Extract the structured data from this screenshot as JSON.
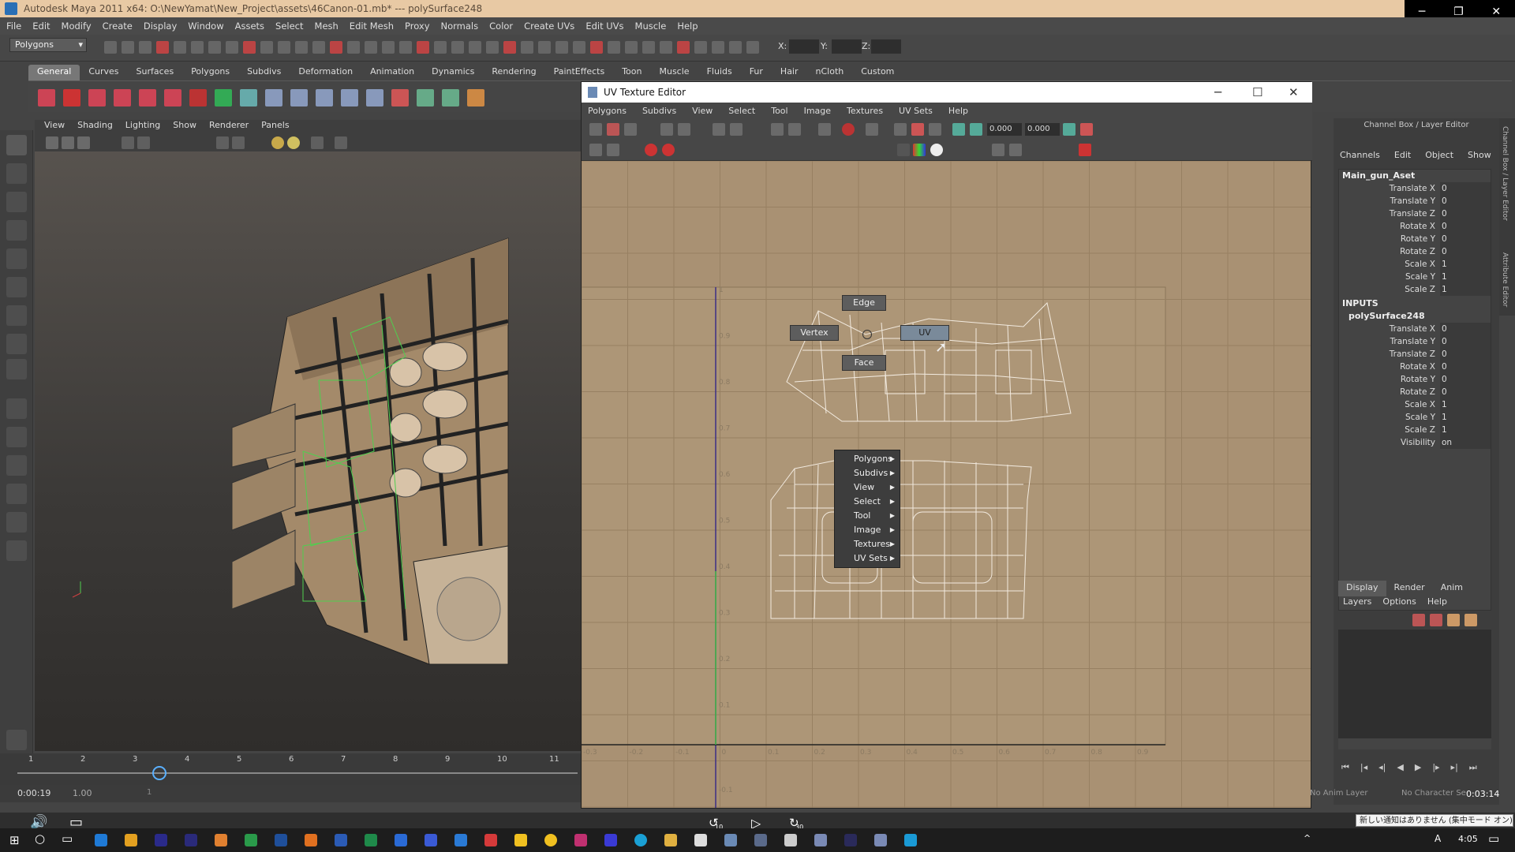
{
  "window": {
    "title": "Autodesk Maya 2011 x64: O:\\NewYamat\\New_Project\\assets\\46Canon-01.mb*   ---   polySurface248",
    "controls": {
      "minimize": "─",
      "restore": "❐",
      "close": "✕"
    }
  },
  "main_menu": [
    "File",
    "Edit",
    "Modify",
    "Create",
    "Display",
    "Window",
    "Assets",
    "Select",
    "Mesh",
    "Edit Mesh",
    "Proxy",
    "Normals",
    "Color",
    "Create UVs",
    "Edit UVs",
    "Muscle",
    "Help"
  ],
  "status_line": {
    "menu_set": "Polygons",
    "x_label": "X:",
    "y_label": "Y:",
    "z_label": "Z:"
  },
  "shelf_tabs": [
    "General",
    "Curves",
    "Surfaces",
    "Polygons",
    "Subdivs",
    "Deformation",
    "Animation",
    "Dynamics",
    "Rendering",
    "PaintEffects",
    "Toon",
    "Muscle",
    "Fluids",
    "Fur",
    "Hair",
    "nCloth",
    "Custom"
  ],
  "shelf_active": "General",
  "viewport": {
    "menu": [
      "View",
      "Shading",
      "Lighting",
      "Show",
      "Renderer",
      "Panels"
    ]
  },
  "timeline": {
    "ticks": [
      "1",
      "2",
      "3",
      "4",
      "5",
      "6",
      "7",
      "8",
      "9",
      "10",
      "11"
    ],
    "current_time": "0:00:19",
    "start": "1.00",
    "range_start": "1"
  },
  "uv_editor": {
    "title": "UV Texture Editor",
    "menu": [
      "Polygons",
      "Subdivs",
      "View",
      "Select",
      "Tool",
      "Image",
      "Textures",
      "UV Sets",
      "Help"
    ],
    "u_value": "0.000",
    "v_value": "0.000",
    "grid_v_labels": [
      "1",
      "0.9",
      "0.8",
      "0.7",
      "0.6",
      "0.5",
      "0.4",
      "0.3",
      "0.2",
      "0.1",
      "-0.1"
    ],
    "grid_u_labels": [
      "-0.3",
      "-0.2",
      "-0.1",
      "0",
      "0.1",
      "0.2",
      "0.3",
      "0.4",
      "0.5",
      "0.6",
      "0.7",
      "0.8",
      "0.9"
    ],
    "marking_menu": {
      "edge": "Edge",
      "vertex": "Vertex",
      "uv": "UV",
      "face": "Face",
      "items": [
        "Polygons",
        "Subdivs",
        "View",
        "Select",
        "Tool",
        "Image",
        "Textures",
        "UV Sets"
      ]
    }
  },
  "channel_box": {
    "header": "Channel Box / Layer Editor",
    "menu": [
      "Channels",
      "Edit",
      "Object",
      "Show"
    ],
    "object": "Main_gun_Aset",
    "attributes": [
      {
        "name": "Translate X",
        "value": "0"
      },
      {
        "name": "Translate Y",
        "value": "0"
      },
      {
        "name": "Translate Z",
        "value": "0"
      },
      {
        "name": "Rotate X",
        "value": "0"
      },
      {
        "name": "Rotate Y",
        "value": "0"
      },
      {
        "name": "Rotate Z",
        "value": "0"
      },
      {
        "name": "Scale X",
        "value": "1"
      },
      {
        "name": "Scale Y",
        "value": "1"
      },
      {
        "name": "Scale Z",
        "value": "1"
      }
    ],
    "inputs_label": "INPUTS",
    "input_node": "polySurface248",
    "input_attributes": [
      {
        "name": "Translate X",
        "value": "0"
      },
      {
        "name": "Translate Y",
        "value": "0"
      },
      {
        "name": "Translate Z",
        "value": "0"
      },
      {
        "name": "Rotate X",
        "value": "0"
      },
      {
        "name": "Rotate Y",
        "value": "0"
      },
      {
        "name": "Rotate Z",
        "value": "0"
      },
      {
        "name": "Scale X",
        "value": "1"
      },
      {
        "name": "Scale Y",
        "value": "1"
      },
      {
        "name": "Scale Z",
        "value": "1"
      },
      {
        "name": "Visibility",
        "value": "on"
      }
    ],
    "side_tabs": [
      "Channel Box / Layer Editor",
      "Attribute Editor"
    ]
  },
  "layer_editor": {
    "tabs": [
      "Display",
      "Render",
      "Anim"
    ],
    "active_tab": "Display",
    "menu": [
      "Layers",
      "Options",
      "Help"
    ]
  },
  "bottom_right": {
    "anim_layer": "No Anim Layer",
    "char_set": "No Character Se",
    "time": "0:03:14"
  },
  "player": {
    "back10": "10",
    "fwd30": "30"
  },
  "taskbar": {
    "clock": "4:05",
    "notification": "新しい通知はありません (集中モード オン)",
    "ime": "A"
  }
}
